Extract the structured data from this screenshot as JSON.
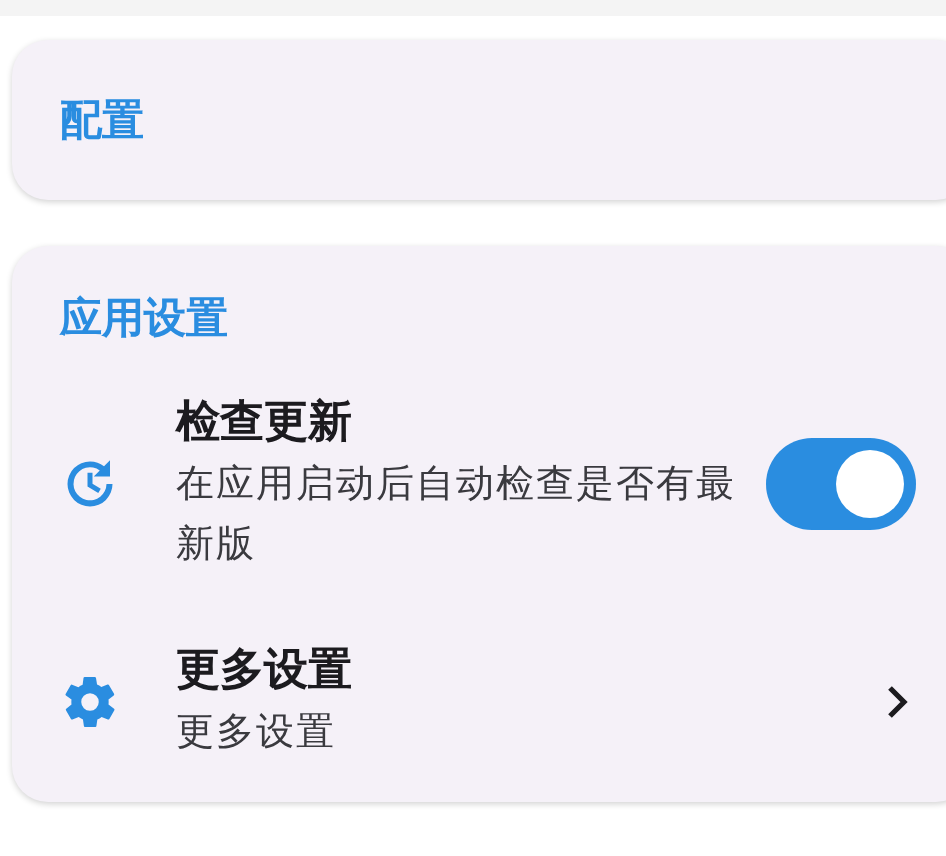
{
  "sections": [
    {
      "title": "配置"
    },
    {
      "title": "应用设置",
      "items": [
        {
          "kind": "switch",
          "title": "检查更新",
          "subtitle": "在应用启动后自动检查是否有最新版",
          "on": true
        },
        {
          "kind": "link",
          "title": "更多设置",
          "subtitle": "更多设置"
        }
      ]
    }
  ]
}
